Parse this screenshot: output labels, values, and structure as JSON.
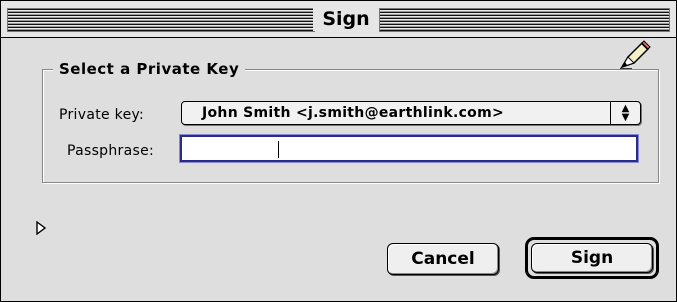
{
  "window": {
    "title": "Sign"
  },
  "icons": {
    "pen": "pen-icon",
    "disclosure": "disclosure-triangle-icon",
    "popup_arrows": "up-down-arrows-icon"
  },
  "group": {
    "title": "Select a Private Key",
    "private_key_label": "Private key:",
    "private_key_value": "John Smith <j.smith@earthlink.com>",
    "passphrase_label": "Passphrase:",
    "passphrase_value": ""
  },
  "buttons": {
    "cancel": "Cancel",
    "sign": "Sign"
  },
  "colors": {
    "field_focus": "#2a2a8a",
    "window_bg": "#dedede"
  }
}
